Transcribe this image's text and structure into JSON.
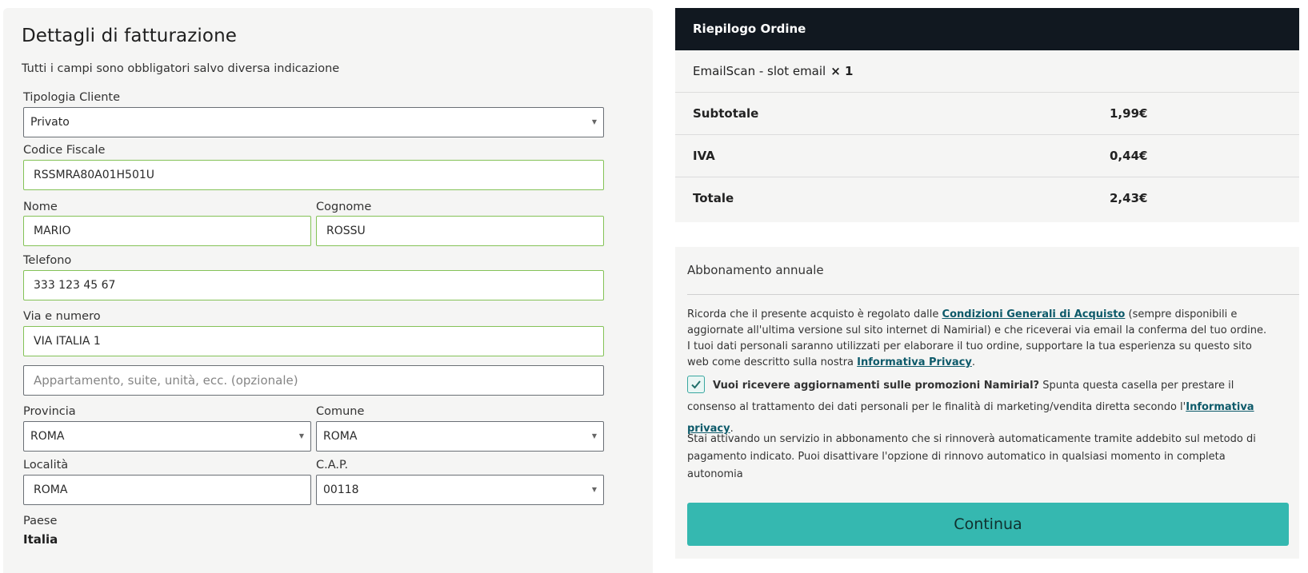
{
  "billing": {
    "title": "Dettagli di fatturazione",
    "note": "Tutti i campi sono obbligatori salvo diversa indicazione",
    "tipologia": {
      "label": "Tipologia Cliente",
      "value": "Privato"
    },
    "codice_fiscale": {
      "label": "Codice Fiscale",
      "value": "RSSMRA80A01H501U"
    },
    "nome": {
      "label": "Nome",
      "value": "MARIO"
    },
    "cognome": {
      "label": "Cognome",
      "value": "ROSSU"
    },
    "telefono": {
      "label": "Telefono",
      "value": "333 123 45 67"
    },
    "via": {
      "label": "Via e numero",
      "value": "VIA ITALIA 1"
    },
    "appartamento": {
      "placeholder": "Appartamento, suite, unità, ecc. (opzionale)"
    },
    "provincia": {
      "label": "Provincia",
      "value": "ROMA"
    },
    "comune": {
      "label": "Comune",
      "value": "ROMA"
    },
    "localita": {
      "label": "Località",
      "value": "ROMA"
    },
    "cap": {
      "label": "C.A.P.",
      "value": "00118"
    },
    "paese": {
      "label": "Paese",
      "value": "Italia"
    }
  },
  "summary": {
    "title": "Riepilogo Ordine",
    "product": "EmailScan - slot email",
    "quantity": "× 1",
    "subtotal_label": "Subtotale",
    "subtotal_value": "1,99€",
    "iva_label": "IVA",
    "iva_value": "0,44€",
    "total_label": "Totale",
    "total_value": "2,43€"
  },
  "subscription": {
    "title": "Abbonamento annuale",
    "terms_prefix": "Ricorda che il presente acquisto è regolato dalle ",
    "terms_link": "Condizioni Generali di Acquisto",
    "terms_suffix": " (sempre disponibili e aggiornate all'ultima versione sul sito internet di Namirial) e che riceverai via email la conferma del tuo ordine.",
    "privacy_prefix": "I tuoi dati personali saranno utilizzati per elaborare il tuo ordine, supportare la tua esperienza su questo sito web come descritto sulla nostra ",
    "privacy_link": "Informativa Privacy",
    "privacy_suffix": ".",
    "marketing_question": "Vuoi ricevere aggiornamenti sulle promozioni Namirial?",
    "marketing_text": " Spunta questa casella per prestare il consenso al trattamento dei dati personali per le finalità di marketing/vendita diretta secondo l'",
    "marketing_link": "Informativa privacy",
    "marketing_suffix": ".",
    "renewal_text": "Stai attivando un servizio in abbonamento che si rinnoverà automaticamente tramite addebito sul metodo di pagamento indicato. Puoi disattivare l'opzione di rinnovo automatico in qualsiasi momento in completa autonomia",
    "continue_label": "Continua"
  },
  "colors": {
    "accent": "#35b8b0",
    "valid_border": "#84c257",
    "header_bg": "#111820",
    "link": "#0d5a6a"
  }
}
